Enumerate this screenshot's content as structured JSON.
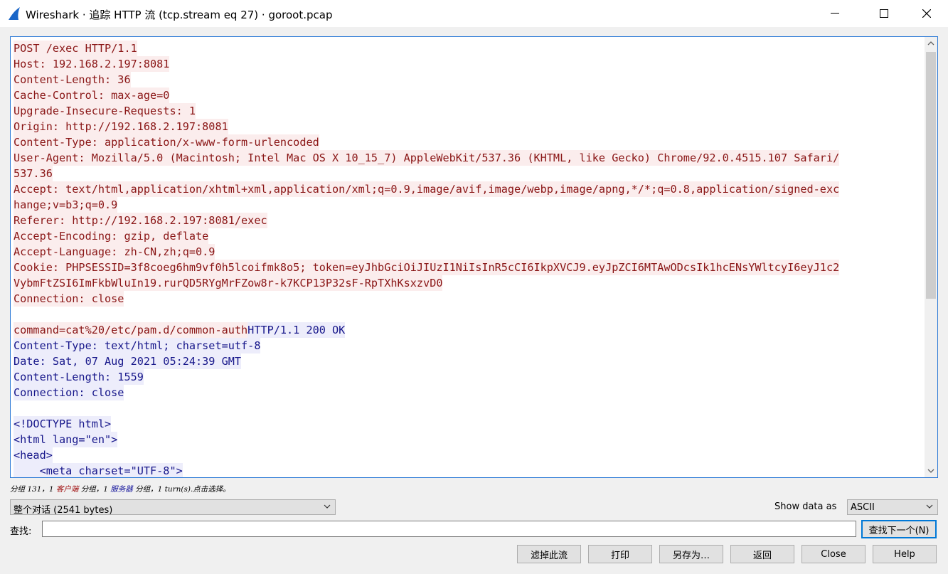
{
  "window": {
    "title": "Wireshark · 追踪 HTTP 流 (tcp.stream eq 27) · goroot.pcap"
  },
  "stream_lines": [
    {
      "t": "POST /exec HTTP/1.1",
      "k": "c"
    },
    {
      "t": "Host: 192.168.2.197:8081",
      "k": "c"
    },
    {
      "t": "Content-Length: 36",
      "k": "c"
    },
    {
      "t": "Cache-Control: max-age=0",
      "k": "c"
    },
    {
      "t": "Upgrade-Insecure-Requests: 1",
      "k": "c"
    },
    {
      "t": "Origin: http://192.168.2.197:8081",
      "k": "c"
    },
    {
      "t": "Content-Type: application/x-www-form-urlencoded",
      "k": "c"
    },
    {
      "t": "User-Agent: Mozilla/5.0 (Macintosh; Intel Mac OS X 10_15_7) AppleWebKit/537.36 (KHTML, like Gecko) Chrome/92.0.4515.107 Safari/",
      "k": "c"
    },
    {
      "t": "537.36",
      "k": "c"
    },
    {
      "t": "Accept: text/html,application/xhtml+xml,application/xml;q=0.9,image/avif,image/webp,image/apng,*/*;q=0.8,application/signed-exc",
      "k": "c"
    },
    {
      "t": "hange;v=b3;q=0.9",
      "k": "c"
    },
    {
      "t": "Referer: http://192.168.2.197:8081/exec",
      "k": "c"
    },
    {
      "t": "Accept-Encoding: gzip, deflate",
      "k": "c"
    },
    {
      "t": "Accept-Language: zh-CN,zh;q=0.9",
      "k": "c"
    },
    {
      "t": "Cookie: PHPSESSID=3f8coeg6hm9vf0h5lcoifmk8o5; token=eyJhbGciOiJIUzI1NiIsInR5cCI6IkpXVCJ9.eyJpZCI6MTAwODcsIk1hcENsYWltcyI6eyJ1c2",
      "k": "c"
    },
    {
      "t": "VybmFtZSI6ImFkbWluIn19.rurQD5RYgMrFZow8r-k7KCP13P32sF-RpTXhKsxzvD0",
      "k": "c"
    },
    {
      "t": "Connection: close",
      "k": "c"
    },
    {
      "t": "",
      "k": ""
    },
    {
      "t": "command=cat%20/etc/pam.d/common-auth",
      "k": "c",
      "t2": "HTTP/1.1 200 OK",
      "k2": "s"
    },
    {
      "t": "Content-Type: text/html; charset=utf-8",
      "k": "s"
    },
    {
      "t": "Date: Sat, 07 Aug 2021 05:24:39 GMT",
      "k": "s"
    },
    {
      "t": "Content-Length: 1559",
      "k": "s"
    },
    {
      "t": "Connection: close",
      "k": "s"
    },
    {
      "t": "",
      "k": ""
    },
    {
      "t": "<!DOCTYPE html>",
      "k": "s"
    },
    {
      "t": "<html lang=\"en\">",
      "k": "s"
    },
    {
      "t": "<head>",
      "k": "s"
    },
    {
      "t": "    <meta charset=\"UTF-8\">",
      "k": "s"
    }
  ],
  "status": {
    "part1": "分组 131，1 ",
    "client": "客户端",
    "part2": " 分组，1 ",
    "server": "服务器",
    "part3": " 分组，1 turn(s).点击选择。"
  },
  "conversation_select": {
    "value": "整个对话 (2541 bytes)"
  },
  "show_data": {
    "label": "Show data as",
    "value": "ASCII"
  },
  "find": {
    "label": "查找:",
    "value": "",
    "next_label": "查找下一个(N)"
  },
  "buttons": {
    "filter_out": "滤掉此流",
    "print": "打印",
    "save_as": "另存为…",
    "back": "返回",
    "close": "Close",
    "help": "Help"
  },
  "colors": {
    "client_bg": "#fbeded",
    "client_fg": "#8a1616",
    "server_bg": "#ededfb",
    "server_fg": "#16168a",
    "accent": "#0078d7"
  }
}
